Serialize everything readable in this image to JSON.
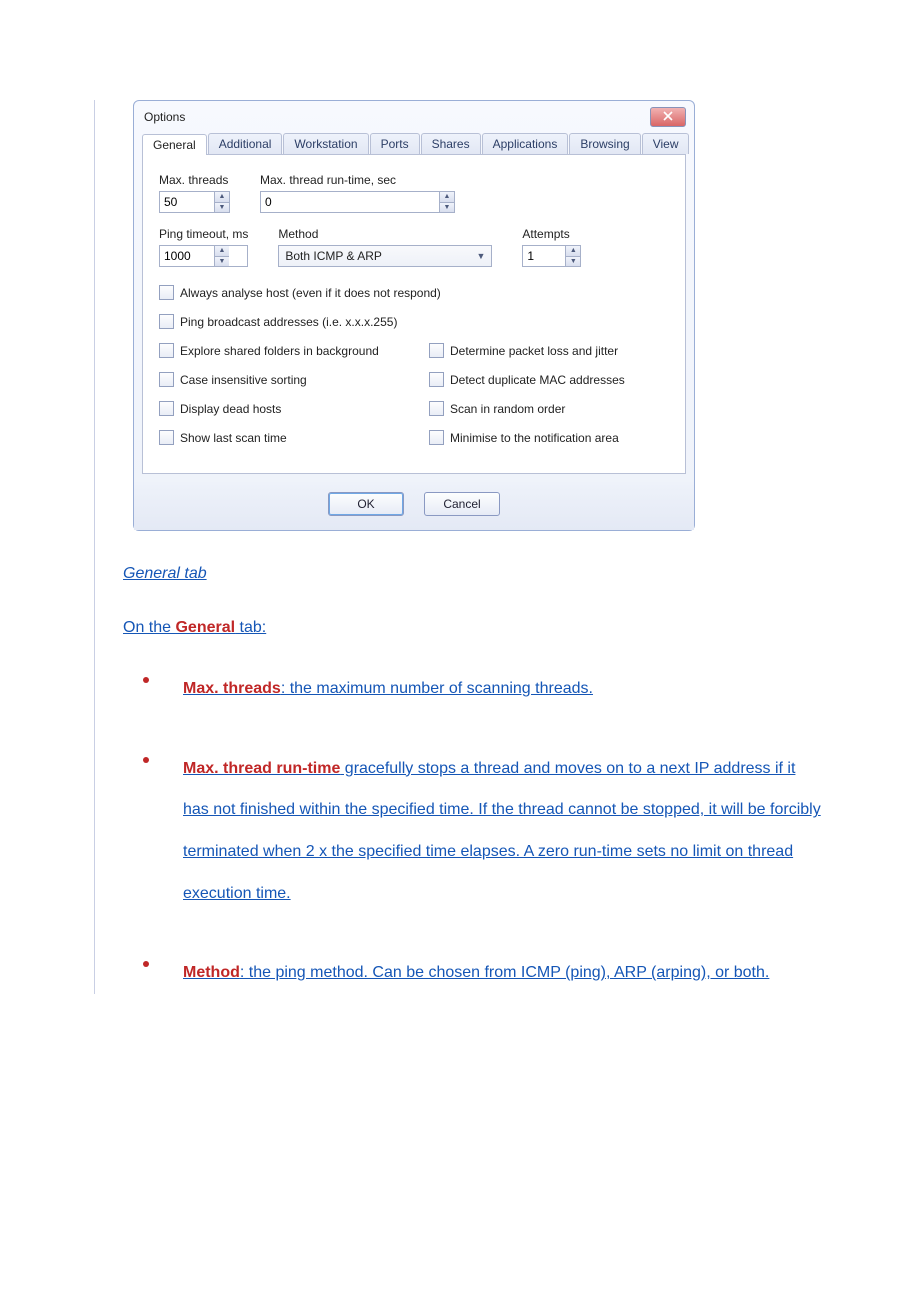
{
  "dialog": {
    "title": "Options",
    "tabs": [
      "General",
      "Additional",
      "Workstation",
      "Ports",
      "Shares",
      "Applications",
      "Browsing",
      "View"
    ],
    "active_tab": 0,
    "fields": {
      "max_threads": {
        "label": "Max. threads",
        "value": "50"
      },
      "max_runtime": {
        "label": "Max. thread run-time, sec",
        "value": "0"
      },
      "ping_timeout": {
        "label": "Ping timeout, ms",
        "value": "1000"
      },
      "method": {
        "label": "Method",
        "value": "Both ICMP & ARP"
      },
      "attempts": {
        "label": "Attempts",
        "value": "1"
      }
    },
    "checkboxes": {
      "always_analyse": "Always analyse host (even if it does not respond)",
      "ping_broadcast": "Ping broadcast addresses (i.e. x.x.x.255)",
      "explore_shared": "Explore shared folders in background",
      "packet_loss": "Determine packet loss and jitter",
      "case_insensitive": "Case insensitive sorting",
      "detect_dup_mac": "Detect duplicate MAC addresses",
      "display_dead": "Display dead hosts",
      "scan_random": "Scan in random order",
      "show_last_scan": "Show last scan time",
      "minimise_tray": "Minimise to the notification area"
    },
    "buttons": {
      "ok": "OK",
      "cancel": "Cancel"
    }
  },
  "article": {
    "caption": "General tab",
    "intro_prefix": "On the ",
    "intro_bold": "General",
    "intro_suffix": " tab:",
    "items": [
      {
        "term": "Max. threads",
        "rest": ": the maximum number of scanning threads."
      },
      {
        "term": "Max. thread run-time",
        "rest": " gracefully stops a thread and moves on to a next IP address if it has not finished within the specified time. If the thread cannot be stopped, it will be forcibly terminated when 2 x the specified time elapses. A zero run-time sets no limit on thread execution time."
      },
      {
        "term": "Method",
        "rest": ": the ping method. Can be chosen from ICMP (ping), ARP (arping), or both."
      }
    ]
  }
}
